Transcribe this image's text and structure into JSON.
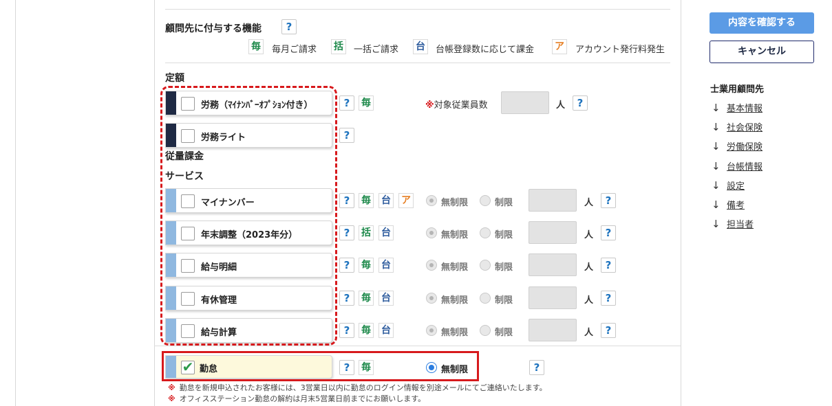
{
  "header": {
    "title": "顧問先に付与する機能"
  },
  "legend": [
    {
      "tag": "毎",
      "text": "毎月ご請求"
    },
    {
      "tag": "括",
      "text": "一括ご請求"
    },
    {
      "tag": "台",
      "text": "台帳登録数に応じて課金"
    },
    {
      "tag": "ア",
      "text": "アカウント発行料発生"
    }
  ],
  "help_glyph": "?",
  "sections": {
    "fixed": "定額",
    "volume": "従量課金",
    "service": "サービス"
  },
  "fixed_items": [
    {
      "label": "労務（ﾏｲﾅﾝﾊﾞｰｵﾌﾟｼｮﾝ付き）",
      "checked": false
    },
    {
      "label": "労務ライト",
      "checked": false
    }
  ],
  "employee_count": {
    "required_mark": "※",
    "label": "対象従業員数",
    "value": "",
    "unit": "人"
  },
  "service_items": [
    {
      "label": "マイナンバー",
      "tags": [
        "毎",
        "台",
        "ア"
      ],
      "radio_unlimited": "無制限",
      "radio_limited": "制限",
      "value": "",
      "unit": "人"
    },
    {
      "label": "年末調整（2023年分）",
      "tags": [
        "括",
        "台"
      ],
      "radio_unlimited": "無制限",
      "radio_limited": "制限",
      "value": "",
      "unit": "人"
    },
    {
      "label": "給与明細",
      "tags": [
        "毎",
        "台"
      ],
      "radio_unlimited": "無制限",
      "radio_limited": "制限",
      "value": "",
      "unit": "人"
    },
    {
      "label": "有休管理",
      "tags": [
        "毎",
        "台"
      ],
      "radio_unlimited": "無制限",
      "radio_limited": "制限",
      "value": "",
      "unit": "人"
    },
    {
      "label": "給与計算",
      "tags": [
        "毎",
        "台"
      ],
      "radio_unlimited": "無制限",
      "radio_limited": "制限",
      "value": "",
      "unit": "人"
    }
  ],
  "kintai": {
    "label": "勤怠",
    "checked": true,
    "check_glyph": "✔",
    "tag": "毎",
    "radio_unlimited": "無制限"
  },
  "notes": [
    {
      "mark": "※",
      "text": "勤怠を新規申込されたお客様には、3営業日以内に勤怠のログイン情報を別途メールにてご連絡いたします。"
    },
    {
      "mark": "※",
      "text": "オフィスステーション勤怠の解約は月末5営業日前までにお願いします。"
    }
  ],
  "actions": {
    "confirm": "内容を確認する",
    "cancel": "キャンセル"
  },
  "sidebar": {
    "title": "士業用顧問先",
    "arrow": "↓",
    "links": [
      "基本情報",
      "社会保険",
      "労働保険",
      "台帳情報",
      "設定",
      "備考",
      "担当者"
    ]
  },
  "colors": {
    "accent": "#5b9be5",
    "navy": "#1f2a44",
    "light_bar": "#8fb8e0",
    "highlight_red": "#d7191c",
    "green_tag": "#1f8a4c",
    "blue_tag": "#2f5d9e",
    "orange_tag": "#e67e22"
  }
}
